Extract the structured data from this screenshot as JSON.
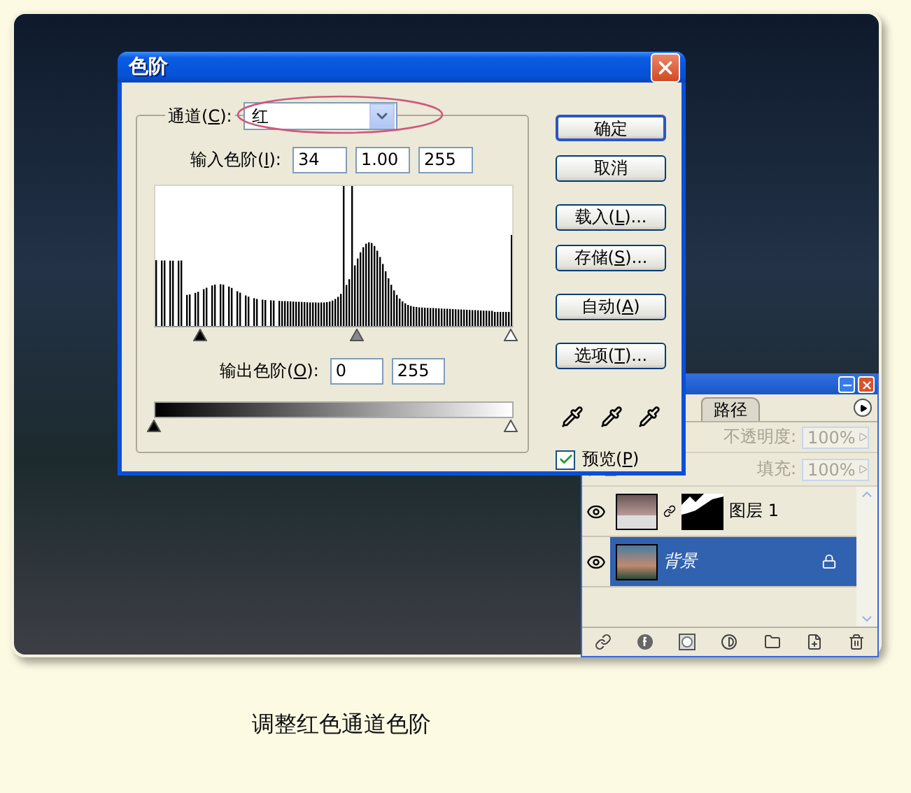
{
  "dialog": {
    "title": "色阶",
    "channel": {
      "label": {
        "pre": "通道(",
        "key": "C",
        "post": "):"
      },
      "value": "红"
    },
    "input_levels": {
      "label": {
        "pre": "输入色阶(",
        "key": "I",
        "post": "):"
      },
      "values": [
        "34",
        "1.00",
        "255"
      ]
    },
    "input_sliders": [
      {
        "kind": "black",
        "level": 0.13
      },
      {
        "kind": "gray",
        "level": 0.57
      },
      {
        "kind": "white",
        "level": 1
      }
    ],
    "output_levels": {
      "label": {
        "pre": "输出色阶(",
        "key": "O",
        "post": "):"
      },
      "values": [
        "0",
        "255"
      ]
    },
    "output_sliders": [
      {
        "kind": "black",
        "level": 0
      },
      {
        "kind": "white",
        "level": 1
      }
    ],
    "button_groups": [
      [
        {
          "label": {
            "pre": "确定"
          },
          "default": true
        },
        {
          "label": {
            "pre": "取消"
          },
          "default": false
        }
      ],
      [
        {
          "label": {
            "pre": "载入(",
            "key": "L",
            "post": ")..."
          },
          "default": false
        },
        {
          "label": {
            "pre": "存储(",
            "key": "S",
            "post": ")..."
          },
          "default": false
        }
      ],
      [
        {
          "label": {
            "pre": "自动(",
            "key": "A",
            "post": ")"
          },
          "default": false
        }
      ],
      [
        {
          "label": {
            "pre": "选项(",
            "key": "T",
            "post": ")..."
          },
          "default": false
        }
      ]
    ],
    "preview": {
      "label": {
        "pre": "预览(",
        "key": "P",
        "post": ")"
      },
      "checked": true
    }
  },
  "layers_panel": {
    "tabs": [
      {
        "label": "路径",
        "selected": false
      }
    ],
    "opacity": {
      "label": "不透明度:",
      "value": "100%",
      "disabled": true
    },
    "fill": {
      "label": "填充:",
      "value": "100%",
      "disabled": true
    },
    "layers": [
      {
        "name": "图层 1",
        "visible": true,
        "selected": false,
        "locked": false,
        "kind": "masked"
      },
      {
        "name": "背景",
        "visible": true,
        "selected": true,
        "locked": true,
        "kind": "plain"
      }
    ]
  },
  "caption": "调整红色通道色阶"
}
